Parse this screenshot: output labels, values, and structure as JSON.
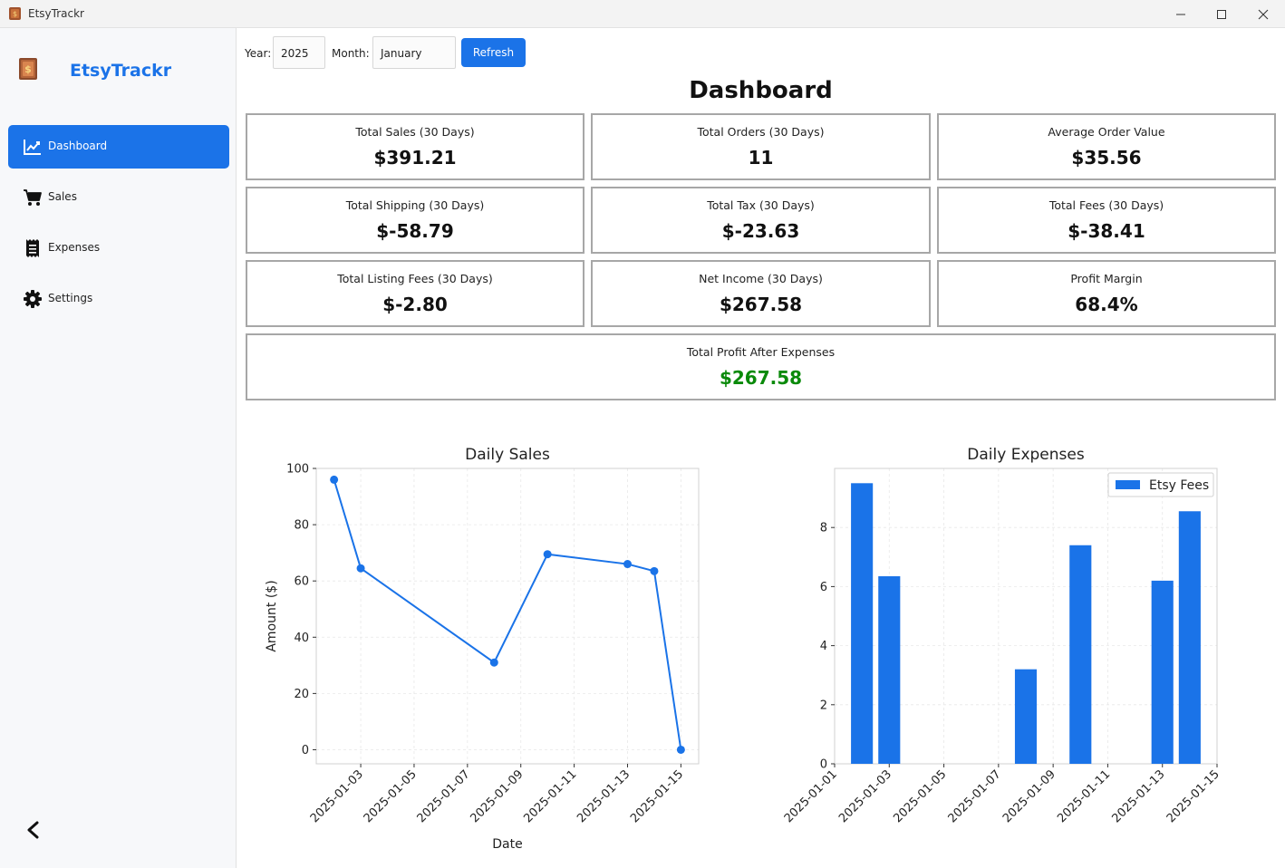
{
  "window": {
    "title": "EtsyTrackr"
  },
  "sidebar": {
    "brand": "EtsyTrackr",
    "items": [
      {
        "label": "Dashboard",
        "icon": "chart-line-icon",
        "active": true
      },
      {
        "label": "Sales",
        "icon": "shopping-cart-icon",
        "active": false
      },
      {
        "label": "Expenses",
        "icon": "receipt-icon",
        "active": false
      },
      {
        "label": "Settings",
        "icon": "gear-icon",
        "active": false
      }
    ]
  },
  "toolbar": {
    "year_label": "Year:",
    "year_value": "2025",
    "month_label": "Month:",
    "month_value": "January",
    "refresh_label": "Refresh"
  },
  "dashboard": {
    "title": "Dashboard",
    "cards": [
      {
        "label": "Total Sales (30 Days)",
        "value": "$391.21"
      },
      {
        "label": "Total Orders (30 Days)",
        "value": "11"
      },
      {
        "label": "Average Order Value",
        "value": "$35.56"
      },
      {
        "label": "Total Shipping (30 Days)",
        "value": "$-58.79"
      },
      {
        "label": "Total Tax (30 Days)",
        "value": "$-23.63"
      },
      {
        "label": "Total Fees (30 Days)",
        "value": "$-38.41"
      },
      {
        "label": "Total Listing Fees (30 Days)",
        "value": "$-2.80"
      },
      {
        "label": "Net Income (30 Days)",
        "value": "$267.58"
      },
      {
        "label": "Profit Margin",
        "value": "68.4%"
      }
    ],
    "profit_card": {
      "label": "Total Profit After Expenses",
      "value": "$267.58"
    }
  },
  "colors": {
    "accent": "#1b73e8",
    "profit_positive": "#0a8a0a",
    "series": "#1a73e8"
  },
  "chart_data": [
    {
      "type": "line",
      "title": "Daily Sales",
      "xlabel": "Date",
      "ylabel": "Amount ($)",
      "x": [
        "2025-01-02",
        "2025-01-03",
        "2025-01-08",
        "2025-01-10",
        "2025-01-13",
        "2025-01-14",
        "2025-01-15"
      ],
      "values": [
        96,
        64.5,
        31,
        69.5,
        66,
        63.5,
        0
      ],
      "xticks": [
        "2025-01-03",
        "2025-01-05",
        "2025-01-07",
        "2025-01-09",
        "2025-01-11",
        "2025-01-13",
        "2025-01-15"
      ],
      "ylim": [
        -5,
        100
      ],
      "yticks": [
        0,
        20,
        40,
        60,
        80,
        100
      ],
      "xlim": [
        "2025-01-01T08:00",
        "2025-01-15T16:00"
      ],
      "grid": true,
      "marker": "circle"
    },
    {
      "type": "bar",
      "title": "Daily Expenses",
      "xlabel": "",
      "ylabel": "",
      "series": [
        {
          "name": "Etsy Fees",
          "x": [
            "2025-01-02",
            "2025-01-03",
            "2025-01-08",
            "2025-01-10",
            "2025-01-13",
            "2025-01-14"
          ],
          "values": [
            9.5,
            6.35,
            3.2,
            7.4,
            6.2,
            8.55
          ]
        }
      ],
      "xticks": [
        "2025-01-01",
        "2025-01-03",
        "2025-01-05",
        "2025-01-07",
        "2025-01-09",
        "2025-01-11",
        "2025-01-13",
        "2025-01-15"
      ],
      "ylim": [
        0,
        10
      ],
      "yticks": [
        0,
        2,
        4,
        6,
        8
      ],
      "xlim": [
        "2025-01-01T00:00",
        "2025-01-15T00:00"
      ],
      "bar_width_days": 0.8,
      "grid": true,
      "legend": "top-right"
    }
  ]
}
